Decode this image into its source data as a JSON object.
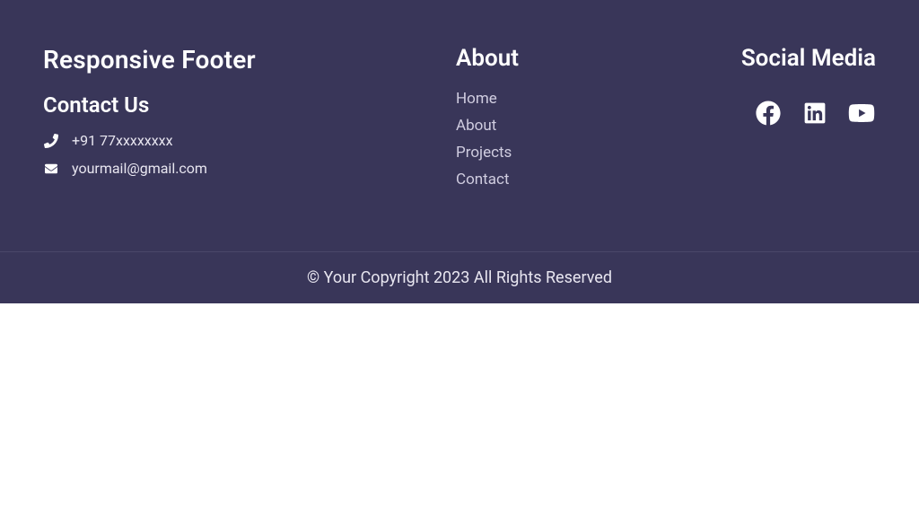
{
  "footer": {
    "title": "Responsive Footer",
    "contact": {
      "heading": "Contact Us",
      "phone": "+91 77xxxxxxxx",
      "email": "yourmail@gmail.com"
    },
    "about": {
      "heading": "About",
      "links": {
        "home": "Home",
        "about": "About",
        "projects": "Projects",
        "contact": "Contact"
      }
    },
    "social": {
      "heading": "Social Media"
    },
    "copyright": "© Your Copyright 2023 All Rights Reserved"
  }
}
